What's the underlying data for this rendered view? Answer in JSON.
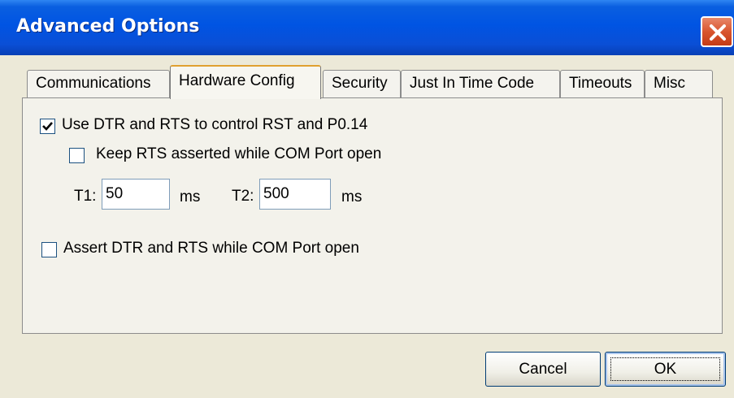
{
  "window": {
    "title": "Advanced Options",
    "close_icon": "close-icon"
  },
  "tabs": [
    {
      "label": "Communications",
      "active": false
    },
    {
      "label": "Hardware Config",
      "active": true
    },
    {
      "label": "Security",
      "active": false
    },
    {
      "label": "Just In Time Code",
      "active": false
    },
    {
      "label": "Timeouts",
      "active": false
    },
    {
      "label": "Misc",
      "active": false
    }
  ],
  "hardware_config": {
    "use_dtr_rts": {
      "label": "Use DTR and RTS to control RST and P0.14",
      "checked": true
    },
    "keep_rts": {
      "label": "Keep RTS asserted while COM Port open",
      "checked": false
    },
    "t1": {
      "label": "T1:",
      "value": "50",
      "unit": "ms"
    },
    "t2": {
      "label": "T2:",
      "value": "500",
      "unit": "ms"
    },
    "assert_dtr_rts": {
      "label": "Assert DTR and RTS while COM Port open",
      "checked": false
    }
  },
  "buttons": {
    "cancel": "Cancel",
    "ok": "OK"
  }
}
